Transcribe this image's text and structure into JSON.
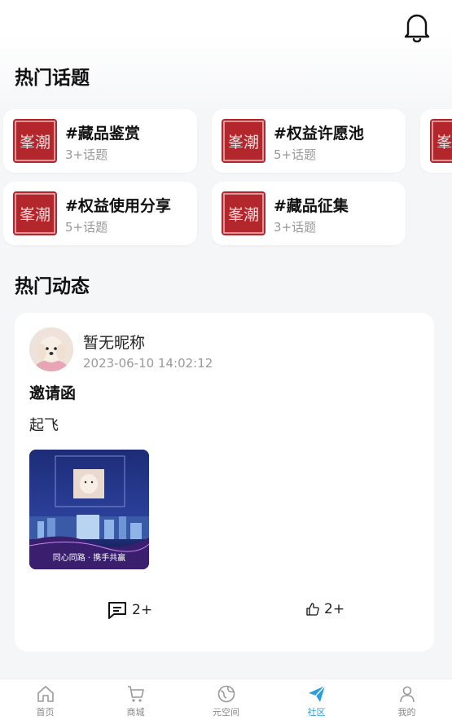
{
  "header": {
    "bell_icon": "bell-icon"
  },
  "hot_topics": {
    "title": "热门话题",
    "seal_text": "峯潮",
    "items": [
      {
        "name": "#藏品鉴赏",
        "count": "3+话题"
      },
      {
        "name": "#权益许愿池",
        "count": "5+话题"
      },
      {
        "name": "#权益使用分享",
        "count": "5+话题"
      },
      {
        "name": "#藏品征集",
        "count": "3+话题"
      }
    ]
  },
  "hot_posts": {
    "title": "热门动态",
    "post": {
      "nickname": "暂无昵称",
      "time": "2023-06-10 14:02:12",
      "title": "邀请函",
      "body": "起飞",
      "image_caption": "同心同路 · 携手共赢",
      "comment_count": "2+",
      "like_count": "2+"
    }
  },
  "tabbar": {
    "items": [
      {
        "label": "首页",
        "icon": "home-icon"
      },
      {
        "label": "商城",
        "icon": "cart-icon"
      },
      {
        "label": "元空间",
        "icon": "globe-icon"
      },
      {
        "label": "社区",
        "icon": "paper-plane-icon"
      },
      {
        "label": "我的",
        "icon": "user-icon"
      }
    ],
    "active_index": 3,
    "active_color": "#2a9ee0"
  }
}
